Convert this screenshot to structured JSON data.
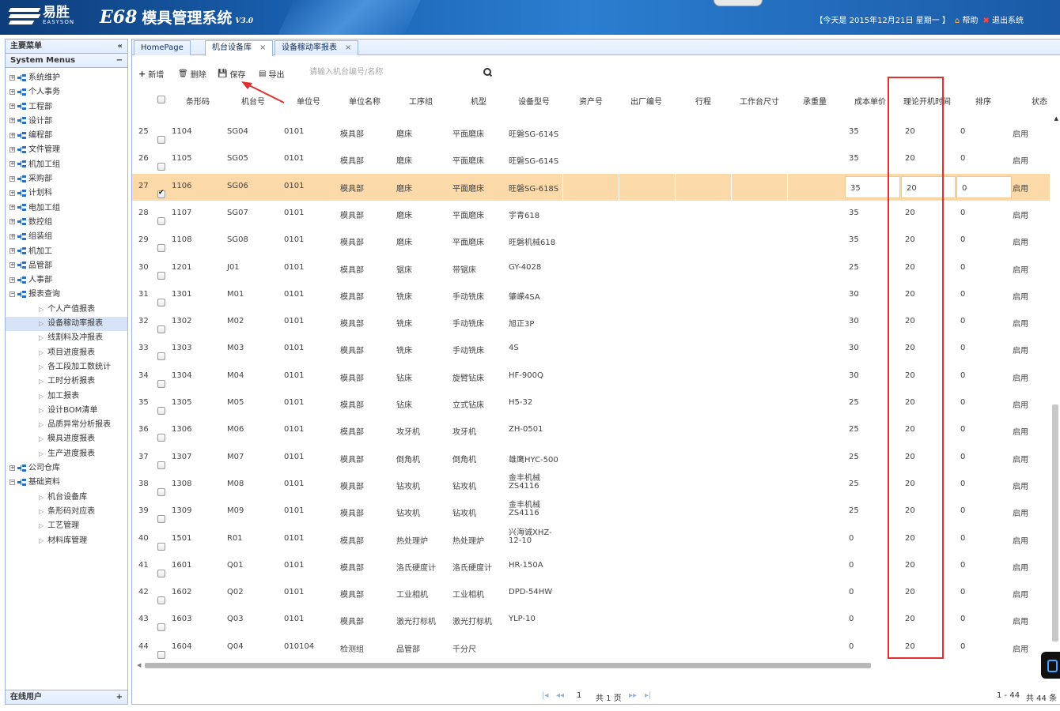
{
  "header": {
    "logo_cn": "易胜",
    "logo_en": "EASYSON",
    "system_title_en": "E68",
    "system_title_cn": "模具管理系统",
    "version": "V3.0",
    "date_text": "【今天是 2015年12月21日 星期一 】",
    "help_label": "帮助",
    "logout_label": "退出系统"
  },
  "sidebar": {
    "title": "主要菜单",
    "collapse_icon": "«",
    "section_title": "System Menus",
    "section_tool": "−",
    "footer_title": "在线用户",
    "footer_tool": "+",
    "top_items": [
      {
        "label": "系统维护",
        "expanded": false
      },
      {
        "label": "个人事务",
        "expanded": false
      },
      {
        "label": "工程部",
        "expanded": false
      },
      {
        "label": "设计部",
        "expanded": false
      },
      {
        "label": "编程部",
        "expanded": false
      },
      {
        "label": "文件管理",
        "expanded": false
      },
      {
        "label": "机加工组",
        "expanded": false
      },
      {
        "label": "采购部",
        "expanded": false
      },
      {
        "label": "计划科",
        "expanded": false
      },
      {
        "label": "电加工组",
        "expanded": false
      },
      {
        "label": "数控组",
        "expanded": false
      },
      {
        "label": "组装组",
        "expanded": false
      },
      {
        "label": "机加工",
        "expanded": false
      },
      {
        "label": "品管部",
        "expanded": false
      },
      {
        "label": "人事部",
        "expanded": false
      },
      {
        "label": "报表查询",
        "expanded": true
      }
    ],
    "report_children": [
      "个人产值报表",
      "设备稼动率报表",
      "线割料及冲报表",
      "项目进度报表",
      "各工段加工数统计",
      "工时分析报表",
      "加工报表",
      "设计BOM清单",
      "品质异常分析报表",
      "模具进度报表",
      "生产进度报表"
    ],
    "mid_items": [
      {
        "label": "公司仓库",
        "expanded": false
      },
      {
        "label": "基础资料",
        "expanded": true
      }
    ],
    "base_children": [
      "机台设备库",
      "条形码对应表",
      "工艺管理",
      "材料库管理"
    ],
    "selected_child": "设备稼动率报表"
  },
  "tabs": [
    {
      "label": "HomePage",
      "closable": false
    },
    {
      "label": "机台设备库",
      "closable": true,
      "active": true
    },
    {
      "label": "设备稼动率报表",
      "closable": true
    }
  ],
  "toolbar": {
    "add_label": "新增",
    "delete_label": "删除",
    "save_label": "保存",
    "export_label": "导出",
    "search_placeholder": "请输入机台编号/名称"
  },
  "grid": {
    "columns": [
      "条形码",
      "机台号",
      "单位号",
      "单位名称",
      "工序组",
      "机型",
      "设备型号",
      "资产号",
      "出厂编号",
      "行程",
      "工作台尺寸",
      "承重量",
      "成本单价",
      "理论开机时间",
      "排序",
      "状态"
    ],
    "selected_row_index": 2,
    "rows": [
      {
        "no": "25",
        "barcode": "1104",
        "machine": "SG04",
        "unit_no": "0101",
        "unit_name": "模具部",
        "group": "磨床",
        "type": "平面磨床",
        "model": "旺磐SG-614S",
        "cost": "35",
        "hours": "20",
        "order": "0",
        "status": "启用"
      },
      {
        "no": "26",
        "barcode": "1105",
        "machine": "SG05",
        "unit_no": "0101",
        "unit_name": "模具部",
        "group": "磨床",
        "type": "平面磨床",
        "model": "旺磐SG-614S",
        "cost": "35",
        "hours": "20",
        "order": "0",
        "status": "启用"
      },
      {
        "no": "27",
        "barcode": "1106",
        "machine": "SG06",
        "unit_no": "0101",
        "unit_name": "模具部",
        "group": "磨床",
        "type": "平面磨床",
        "model": "旺磐SG-618S",
        "cost": "35",
        "hours": "20",
        "order": "0",
        "status": "启用"
      },
      {
        "no": "28",
        "barcode": "1107",
        "machine": "SG07",
        "unit_no": "0101",
        "unit_name": "模具部",
        "group": "磨床",
        "type": "平面磨床",
        "model": "宇青618",
        "cost": "35",
        "hours": "20",
        "order": "0",
        "status": "启用"
      },
      {
        "no": "29",
        "barcode": "1108",
        "machine": "SG08",
        "unit_no": "0101",
        "unit_name": "模具部",
        "group": "磨床",
        "type": "平面磨床",
        "model": "旺磐机械618",
        "cost": "35",
        "hours": "20",
        "order": "0",
        "status": "启用"
      },
      {
        "no": "30",
        "barcode": "1201",
        "machine": "J01",
        "unit_no": "0101",
        "unit_name": "模具部",
        "group": "锯床",
        "type": "带锯床",
        "model": "GY-4028",
        "cost": "25",
        "hours": "20",
        "order": "0",
        "status": "启用"
      },
      {
        "no": "31",
        "barcode": "1301",
        "machine": "M01",
        "unit_no": "0101",
        "unit_name": "模具部",
        "group": "铣床",
        "type": "手动铣床",
        "model": "肇嵘4SA",
        "cost": "30",
        "hours": "20",
        "order": "0",
        "status": "启用"
      },
      {
        "no": "32",
        "barcode": "1302",
        "machine": "M02",
        "unit_no": "0101",
        "unit_name": "模具部",
        "group": "铣床",
        "type": "手动铣床",
        "model": "旭正3P",
        "cost": "30",
        "hours": "20",
        "order": "0",
        "status": "启用"
      },
      {
        "no": "33",
        "barcode": "1303",
        "machine": "M03",
        "unit_no": "0101",
        "unit_name": "模具部",
        "group": "铣床",
        "type": "手动铣床",
        "model": "4S",
        "cost": "30",
        "hours": "20",
        "order": "0",
        "status": "启用"
      },
      {
        "no": "34",
        "barcode": "1304",
        "machine": "M04",
        "unit_no": "0101",
        "unit_name": "模具部",
        "group": "钻床",
        "type": "旋臂钻床",
        "model": "HF-900Q",
        "cost": "30",
        "hours": "20",
        "order": "0",
        "status": "启用"
      },
      {
        "no": "35",
        "barcode": "1305",
        "machine": "M05",
        "unit_no": "0101",
        "unit_name": "模具部",
        "group": "钻床",
        "type": "立式钻床",
        "model": "H5-32",
        "cost": "25",
        "hours": "20",
        "order": "0",
        "status": "启用"
      },
      {
        "no": "36",
        "barcode": "1306",
        "machine": "M06",
        "unit_no": "0101",
        "unit_name": "模具部",
        "group": "攻牙机",
        "type": "攻牙机",
        "model": "ZH-0501",
        "cost": "25",
        "hours": "20",
        "order": "0",
        "status": "启用"
      },
      {
        "no": "37",
        "barcode": "1307",
        "machine": "M07",
        "unit_no": "0101",
        "unit_name": "模具部",
        "group": "倒角机",
        "type": "倒角机",
        "model": "雄鹰HYC-500",
        "cost": "25",
        "hours": "20",
        "order": "0",
        "status": "启用"
      },
      {
        "no": "38",
        "barcode": "1308",
        "machine": "M08",
        "unit_no": "0101",
        "unit_name": "模具部",
        "group": "钻攻机",
        "type": "钻攻机",
        "model": "金丰机械",
        "model2": "ZS4116",
        "cost": "25",
        "hours": "20",
        "order": "0",
        "status": "启用"
      },
      {
        "no": "39",
        "barcode": "1309",
        "machine": "M09",
        "unit_no": "0101",
        "unit_name": "模具部",
        "group": "钻攻机",
        "type": "钻攻机",
        "model": "金丰机械",
        "model2": "ZS4116",
        "cost": "25",
        "hours": "20",
        "order": "0",
        "status": "启用"
      },
      {
        "no": "40",
        "barcode": "1501",
        "machine": "R01",
        "unit_no": "0101",
        "unit_name": "模具部",
        "group": "热处理炉",
        "type": "热处理炉",
        "model": "兴海诚XHZ-",
        "model2": "12-10",
        "cost": "0",
        "hours": "20",
        "order": "0",
        "status": "启用"
      },
      {
        "no": "41",
        "barcode": "1601",
        "machine": "Q01",
        "unit_no": "0101",
        "unit_name": "模具部",
        "group": "洛氏硬度计",
        "type": "洛氏硬度计",
        "model": "HR-150A",
        "cost": "0",
        "hours": "20",
        "order": "0",
        "status": "启用"
      },
      {
        "no": "42",
        "barcode": "1602",
        "machine": "Q02",
        "unit_no": "0101",
        "unit_name": "模具部",
        "group": "工业相机",
        "type": "工业相机",
        "model": "DPD-54HW",
        "cost": "0",
        "hours": "20",
        "order": "0",
        "status": "启用"
      },
      {
        "no": "43",
        "barcode": "1603",
        "machine": "Q03",
        "unit_no": "0101",
        "unit_name": "模具部",
        "group": "激光打标机",
        "type": "激光打标机",
        "model": "YLP-10",
        "cost": "0",
        "hours": "20",
        "order": "0",
        "status": "启用"
      },
      {
        "no": "44",
        "barcode": "1604",
        "machine": "Q04",
        "unit_no": "010104",
        "unit_name": "检测组",
        "group": "品管部",
        "type": "千分尺",
        "model": "",
        "cost": "0",
        "hours": "20",
        "order": "0",
        "status": "启用"
      }
    ]
  },
  "pager": {
    "page": "1",
    "total_pages": "共 1 页",
    "range": "1 - 44",
    "total": "共 44 条"
  },
  "colors": {
    "header_bg": "#1a62b3",
    "selected_row": "#fbd9a8",
    "highlight_box": "#e03030",
    "panel_border": "#95b8e7"
  }
}
